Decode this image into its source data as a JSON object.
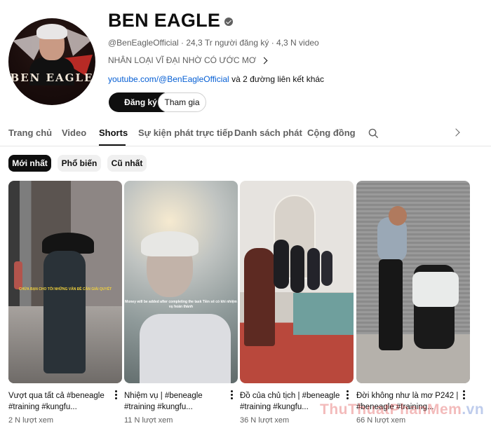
{
  "channel": {
    "avatar_brand_text": "BEN EAGLE",
    "title": "BEN EAGLE",
    "handle": "@BenEagleOfficial",
    "subscribers": "24,3 Tr người đăng ký",
    "videos": "4,3 N video",
    "separator": "·",
    "description": "NHÂN LOẠI VĨ ĐẠI NHỜ CÓ ƯỚC MƠ",
    "link_text": "youtube.com/@BenEagleOfficial",
    "more_links": " và 2 đường liên kết khác",
    "subscribe_label": "Đăng ký",
    "join_label": "Tham gia"
  },
  "tabs": [
    "Trang chủ",
    "Video",
    "Shorts",
    "Sự kiện phát trực tiếp",
    "Danh sách phát",
    "Cộng đồng"
  ],
  "active_tab": "Shorts",
  "chips": [
    "Mới nhất",
    "Phổ biến",
    "Cũ nhất"
  ],
  "active_chip": "Mới nhất",
  "shorts": [
    {
      "title": "Vượt qua tất cả #beneagle #training #kungfu...",
      "views": "2 N lượt xem",
      "overlay": "CHỨA BẠN CHO TÔI NHỮNG VẤN ĐỀ CẦN GIẢI QUYẾT"
    },
    {
      "title": "Nhiệm vụ | #beneagle #training #kungfu...",
      "views": "11 N lượt xem",
      "overlay": "Money will be added after completing the task Tiền sẽ có khi nhiệm vụ hoàn thành"
    },
    {
      "title": "Đồ của chủ tịch | #beneagle #training #kungfu...",
      "views": "36 N lượt xem",
      "overlay": ""
    },
    {
      "title": "Đời không như là mơ P242 | #beneagle #training...",
      "views": "66 N lượt xem",
      "overlay": ""
    }
  ],
  "watermark": {
    "part1": "ThuThuat",
    "part2": "PhanMem",
    "part3": ".vn"
  },
  "colors": {
    "primary_text": "#0f0f0f",
    "secondary_text": "#606060",
    "link": "#065fd4",
    "chip_bg": "#f0f0f0"
  }
}
